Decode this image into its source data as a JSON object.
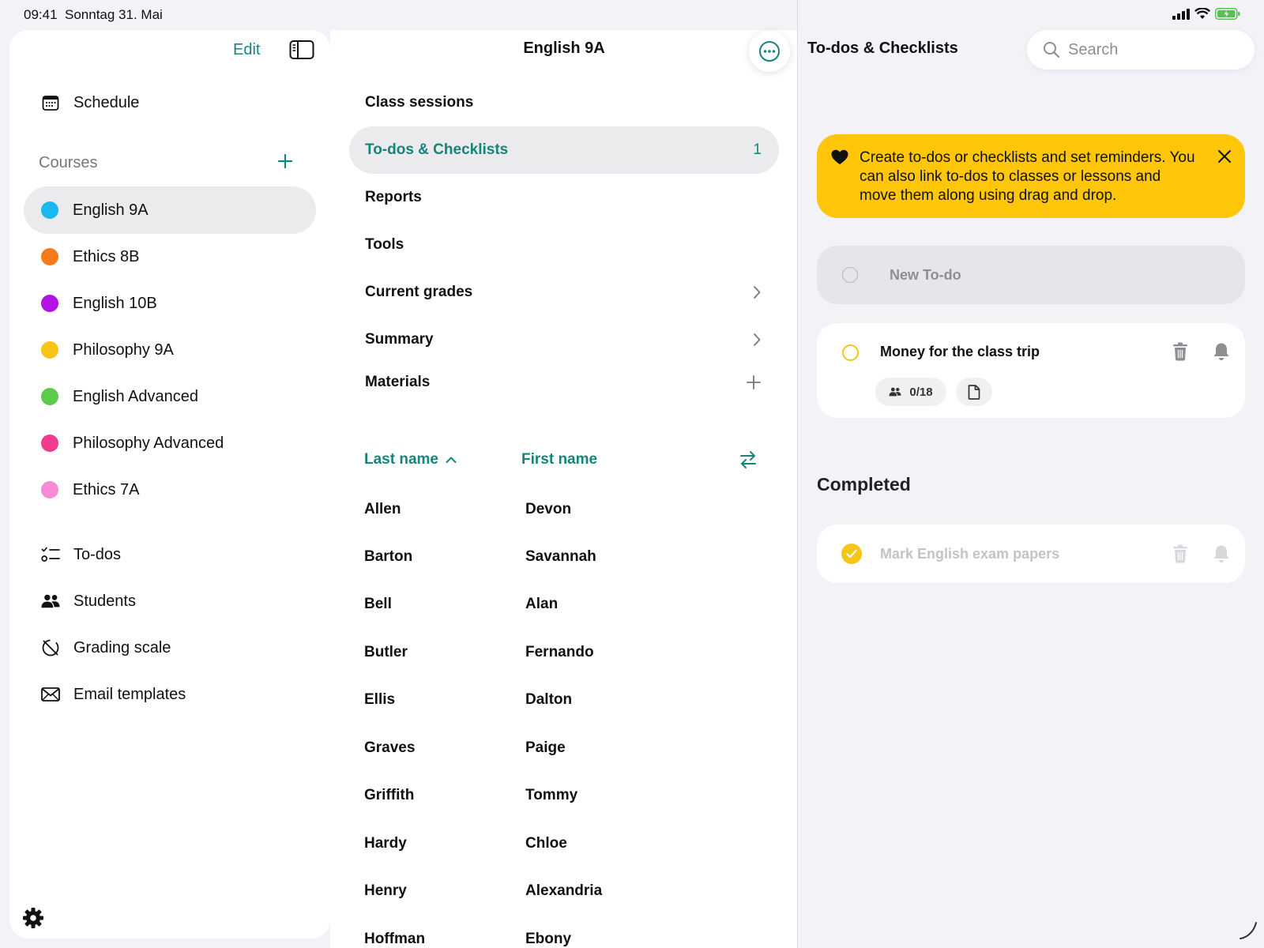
{
  "status_bar": {
    "time": "09:41",
    "date": "Sonntag 31. Mai"
  },
  "sidebar": {
    "edit_label": "Edit",
    "schedule_label": "Schedule",
    "courses_label": "Courses",
    "courses": [
      {
        "label": "English 9A",
        "color": "#19b8f0",
        "active": true
      },
      {
        "label": "Ethics 8B",
        "color": "#f57a1a"
      },
      {
        "label": "English 10B",
        "color": "#b512e6"
      },
      {
        "label": "Philosophy 9A",
        "color": "#f9c416"
      },
      {
        "label": "English Advanced",
        "color": "#5ccb4b"
      },
      {
        "label": "Philosophy Advanced",
        "color": "#f03c8e"
      },
      {
        "label": "Ethics 7A",
        "color": "#f98ad4"
      }
    ],
    "bottom_items": [
      {
        "label": "To-dos",
        "icon": "todo-list-icon"
      },
      {
        "label": "Students",
        "icon": "people-icon"
      },
      {
        "label": "Grading scale",
        "icon": "grading-scale-icon"
      },
      {
        "label": "Email templates",
        "icon": "envelope-icon"
      }
    ]
  },
  "middle": {
    "title": "English 9A",
    "menu": [
      {
        "label": "Class sessions"
      },
      {
        "label": "To-dos & Checklists",
        "count": "1",
        "active": true
      },
      {
        "label": "Reports"
      },
      {
        "label": "Tools"
      },
      {
        "label": "Current grades",
        "chevron": true
      },
      {
        "label": "Summary",
        "chevron": true
      },
      {
        "label": "Materials",
        "add": true
      }
    ],
    "table": {
      "last_name_header": "Last name",
      "first_name_header": "First name",
      "rows": [
        [
          "Allen",
          "Devon"
        ],
        [
          "Barton",
          "Savannah"
        ],
        [
          "Bell",
          "Alan"
        ],
        [
          "Butler",
          "Fernando"
        ],
        [
          "Ellis",
          "Dalton"
        ],
        [
          "Graves",
          "Paige"
        ],
        [
          "Griffith",
          "Tommy"
        ],
        [
          "Hardy",
          "Chloe"
        ],
        [
          "Henry",
          "Alexandria"
        ],
        [
          "Hoffman",
          "Ebony"
        ]
      ]
    }
  },
  "right": {
    "title": "To-dos & Checklists",
    "search_placeholder": "Search",
    "banner_text": "Create to-dos or checklists and set reminders. You can also link to-dos to classes or lessons and move them along using drag and drop.",
    "new_todo_placeholder": "New To-do",
    "todo": {
      "title": "Money for the class trip",
      "students_count": "0/18"
    },
    "completed_heading": "Completed",
    "completed_todo": {
      "title": "Mark English exam papers"
    }
  },
  "colors": {
    "accent": "#12867a",
    "banner": "#ffc60a",
    "check": "#f5c518"
  }
}
